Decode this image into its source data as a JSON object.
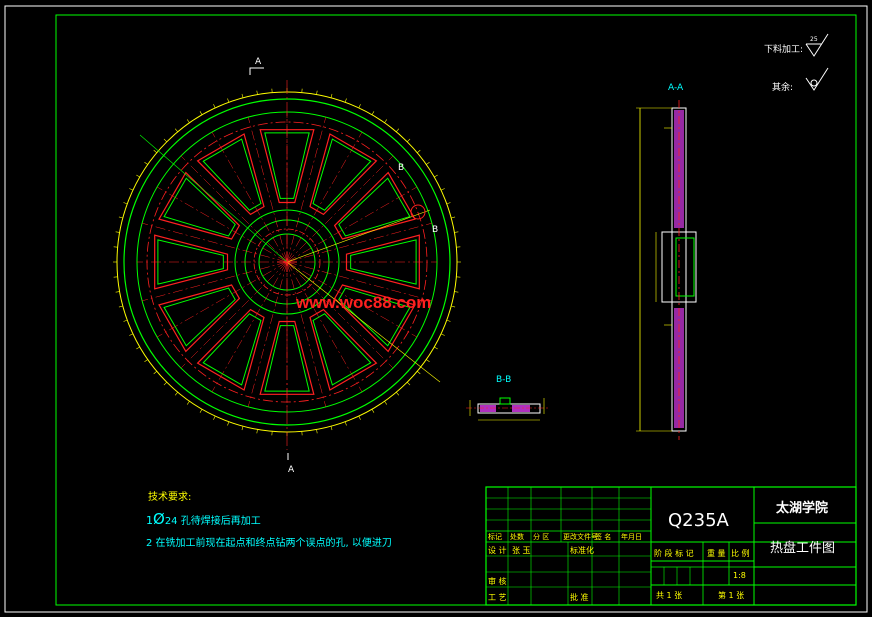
{
  "drawing": {
    "watermark": "www.woc88.com",
    "section_marks": {
      "a": "A",
      "b": "B"
    },
    "section_titles": {
      "aa": "A-A",
      "bb": "B-B"
    },
    "surface_finish": {
      "label1": "下料加工:",
      "label1_value": "25",
      "label2": "其余:"
    },
    "tech_requirements": {
      "heading": "技术要求:",
      "line1_prefix": "1",
      "line1_symbol": "Ø",
      "line1_rest": "24 孔待焊接后再加工",
      "line2": "2 在铣加工前现在起点和终点钻两个误点的孔, 以便进刀"
    },
    "title_block": {
      "material": "Q235A",
      "school": "太湖学院",
      "drawing_name": "热盘工件图",
      "rev_headers": [
        "标记",
        "处数",
        "分 区",
        "更改文件号",
        "签 名",
        "年月日"
      ],
      "designer_label": "设 计",
      "designer_name": "张 玉",
      "standardize_label": "标准化",
      "stage_labels": [
        "阶 段 标 记",
        "重 量",
        "比 例"
      ],
      "scale": "1:8",
      "review_label": "审 核",
      "process_label": "工 艺",
      "approve_label": "批 准",
      "sheet_total": "共 1 张",
      "sheet_number": "第 1 张"
    },
    "colors": {
      "frame": "#00ff00",
      "outline": "#00ff00",
      "slot": "#ff2020",
      "center": "#ff2020",
      "dimension": "#ffff00",
      "hatch": "#b030c0",
      "text": "#ffffff"
    }
  }
}
